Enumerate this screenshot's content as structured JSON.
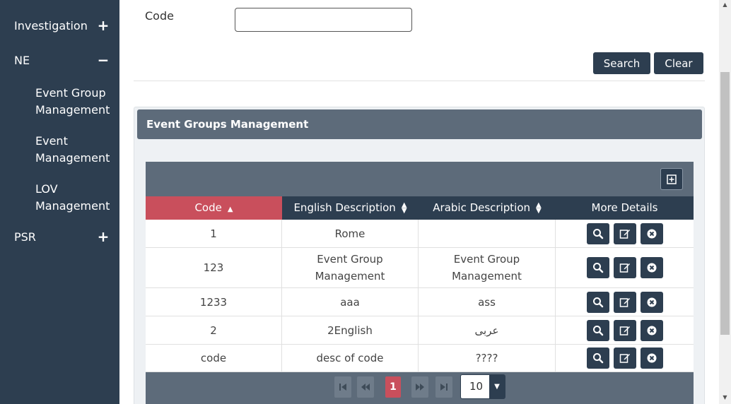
{
  "sidebar": {
    "items": [
      {
        "label": "Investigation",
        "toggle": "+"
      },
      {
        "label": "NE",
        "toggle": "−"
      },
      {
        "label": "PSR",
        "toggle": "+"
      }
    ],
    "sub_items": [
      {
        "label": "Event Group Management"
      },
      {
        "label": "Event Management"
      },
      {
        "label": "LOV Management"
      }
    ]
  },
  "search": {
    "code_label": "Code",
    "code_value": "",
    "search_label": "Search",
    "clear_label": "Clear"
  },
  "panel": {
    "title": "Event Groups Management"
  },
  "table": {
    "columns": [
      {
        "label": "Code",
        "sort": "asc"
      },
      {
        "label": "English Description",
        "sort": "both"
      },
      {
        "label": "Arabic Description",
        "sort": "both"
      },
      {
        "label": "More Details",
        "sort": "none"
      }
    ],
    "rows": [
      {
        "code": "1",
        "english": "Rome",
        "arabic": ""
      },
      {
        "code": "123",
        "english": "Event Group Management",
        "arabic": "Event Group Management"
      },
      {
        "code": "1233",
        "english": "aaa",
        "arabic": "ass"
      },
      {
        "code": "2",
        "english": "2English",
        "arabic": "عربى"
      },
      {
        "code": "code",
        "english": "desc of code",
        "arabic": "????"
      }
    ]
  },
  "pager": {
    "current_page": "1",
    "page_size": "10"
  },
  "colors": {
    "sidebar_bg": "#2d3e50",
    "header_bg": "#5d6b7a",
    "accent_sorted": "#c94f5c"
  }
}
